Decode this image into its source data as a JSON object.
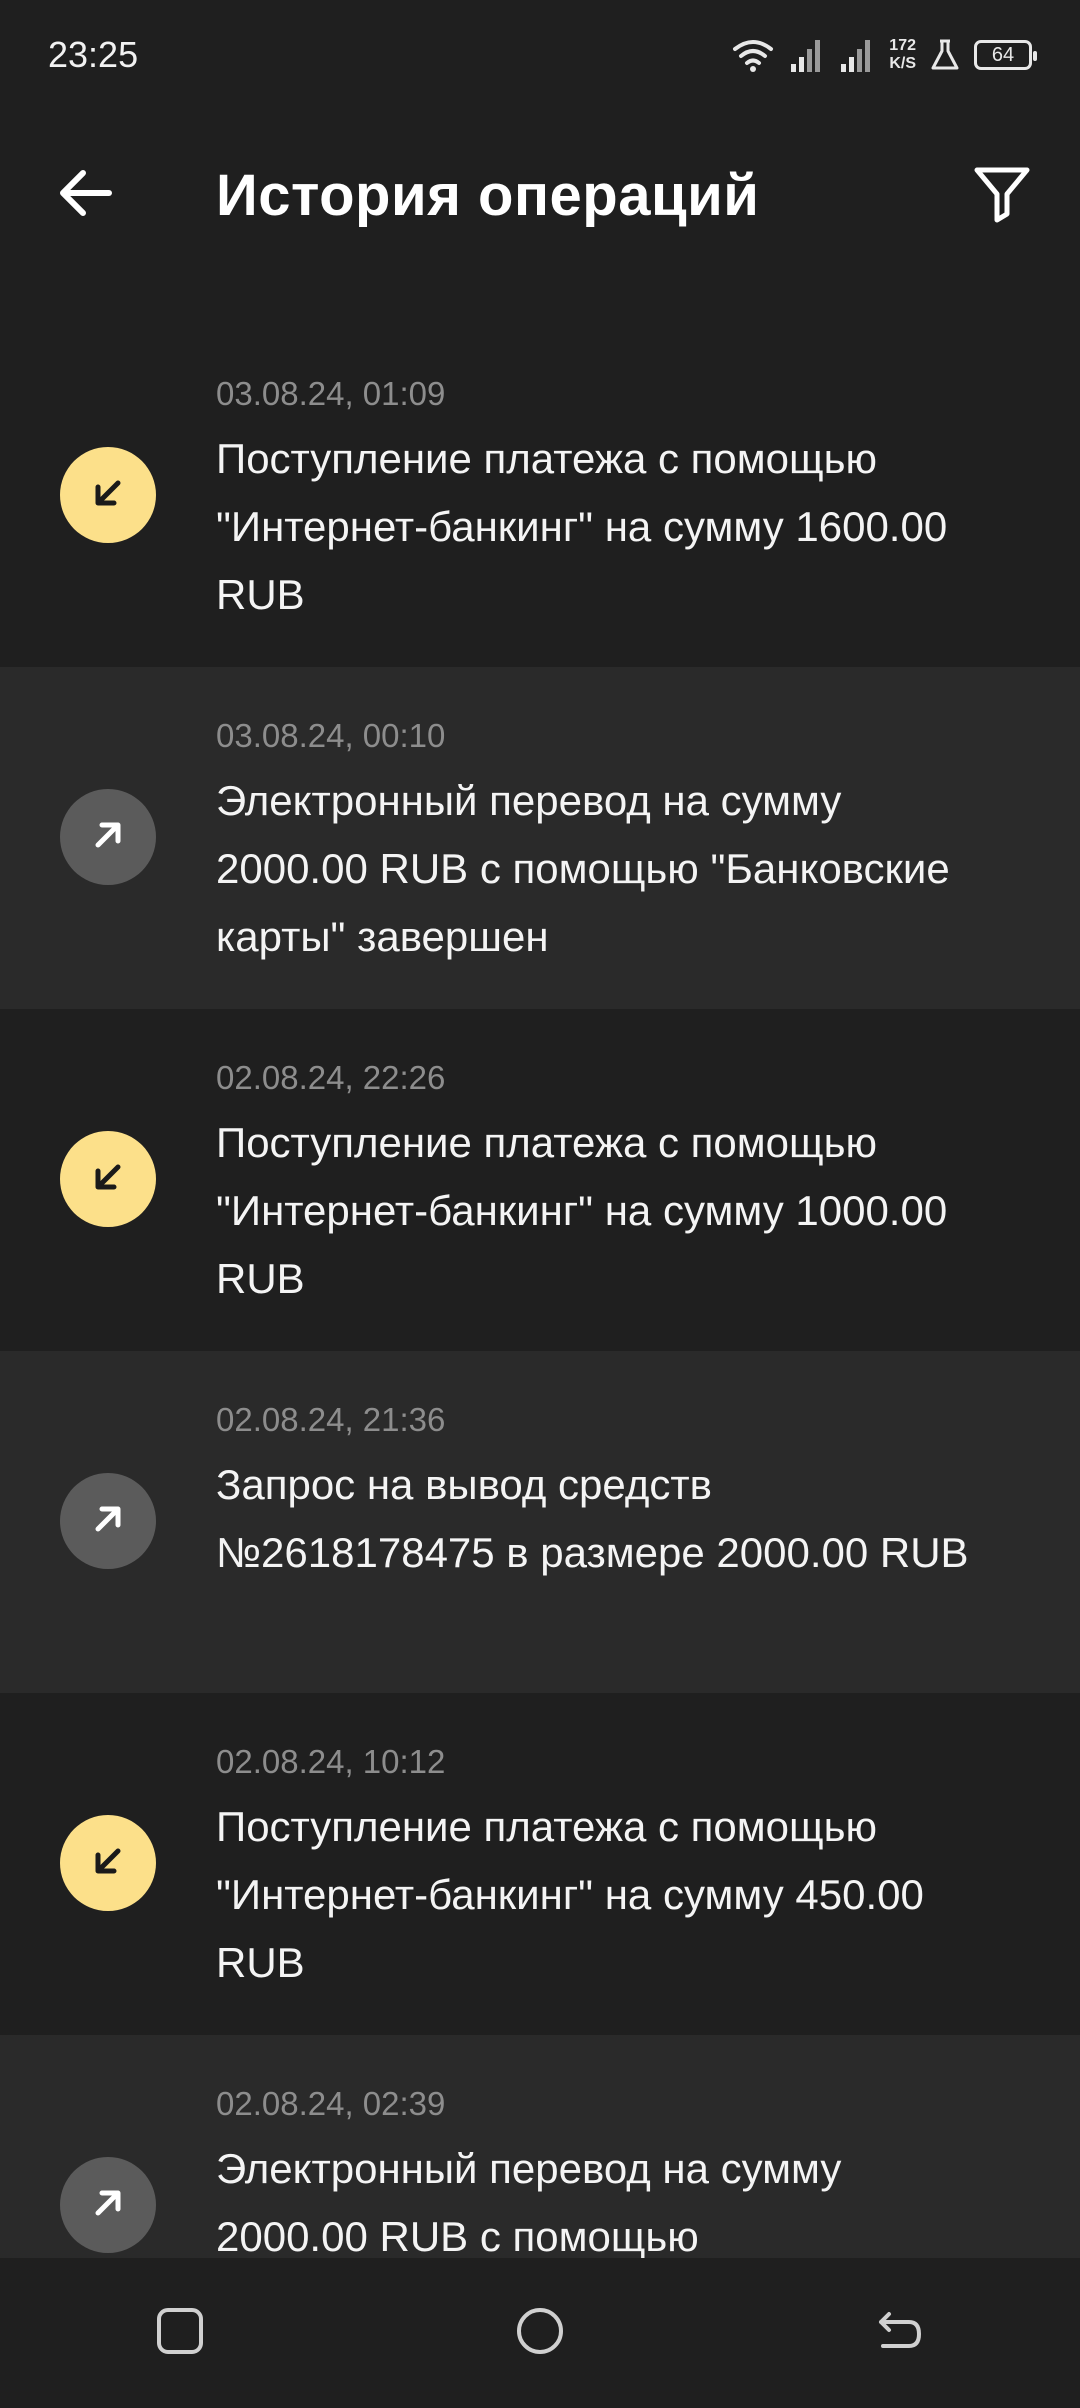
{
  "status_bar": {
    "time": "23:25",
    "net_speed_value": "172",
    "net_speed_unit": "K/S",
    "battery": "64"
  },
  "header": {
    "title": "История операций"
  },
  "operations": [
    {
      "date": "03.08.24, 01:09",
      "text": "Поступление платежа с помощью \"Интернет-банкинг\" на сумму 1600.00 RUB",
      "direction": "incoming"
    },
    {
      "date": "03.08.24, 00:10",
      "text": "Электронный перевод на сумму 2000.00 RUB с помощью \"Банковские карты\" завершен",
      "direction": "outgoing"
    },
    {
      "date": "02.08.24, 22:26",
      "text": "Поступление платежа с помощью \"Интернет-банкинг\" на сумму 1000.00 RUB",
      "direction": "incoming"
    },
    {
      "date": "02.08.24, 21:36",
      "text": "Запрос на вывод средств №2618178475 в размере 2000.00 RUB",
      "direction": "outgoing"
    },
    {
      "date": "02.08.24, 10:12",
      "text": "Поступление платежа с помощью \"Интернет-банкинг\" на сумму 450.00 RUB",
      "direction": "incoming"
    },
    {
      "date": "02.08.24, 02:39",
      "text": "Электронный перевод на сумму 2000.00 RUB с помощью",
      "direction": "outgoing"
    }
  ],
  "colors": {
    "background": "#1f1f1f",
    "row_alt": "#2a2a2a",
    "incoming_icon_bg": "#fce08a",
    "outgoing_icon_bg": "#5b5b5b"
  },
  "icons": {
    "back": "arrow-left-icon",
    "filter": "funnel-icon",
    "incoming": "arrow-down-left-icon",
    "outgoing": "arrow-up-right-icon"
  }
}
